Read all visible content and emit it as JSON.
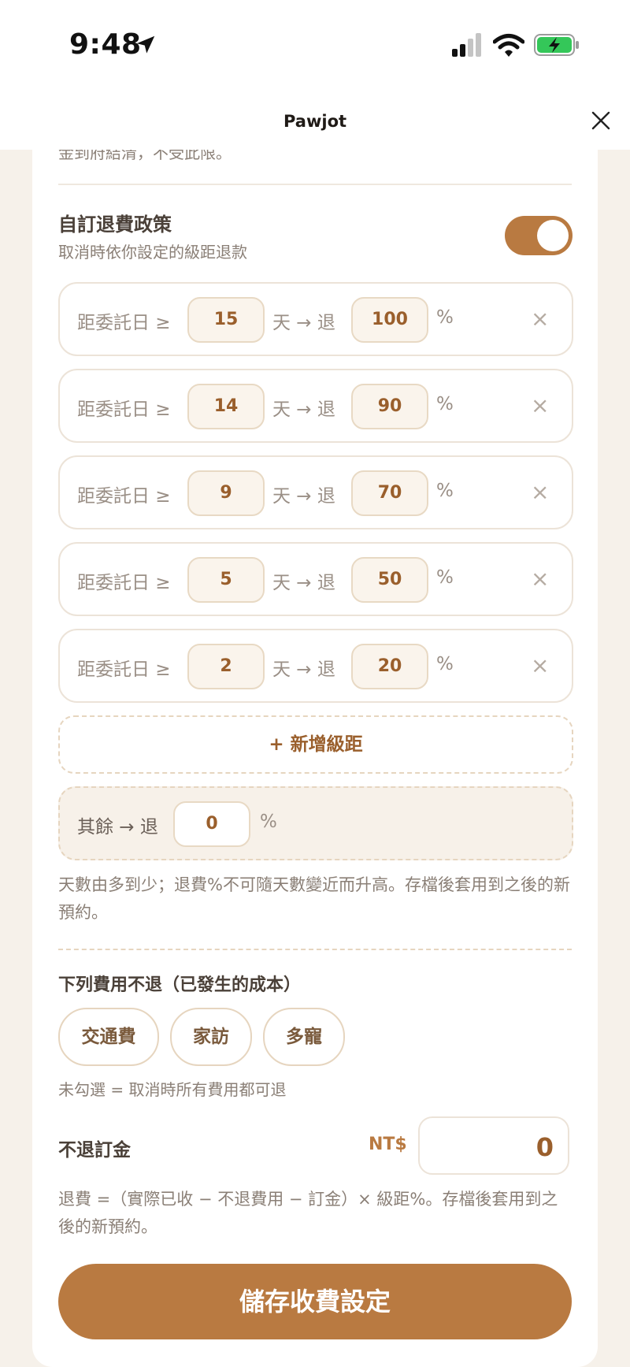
{
  "status_bar": {
    "time": "9:48"
  },
  "nav": {
    "title": "Pawjot"
  },
  "clipped_text": "金到府結清，不受此限。",
  "policy": {
    "title": "自訂退費政策",
    "subtitle": "取消時依你設定的級距退款",
    "enabled": true
  },
  "tier_labels": {
    "prefix": "距委託日 ≥",
    "middle": "天 → 退",
    "percent": "%",
    "remove": "×"
  },
  "tiers": [
    {
      "days": "15",
      "refund": "100"
    },
    {
      "days": "14",
      "refund": "90"
    },
    {
      "days": "9",
      "refund": "70"
    },
    {
      "days": "5",
      "refund": "50"
    },
    {
      "days": "2",
      "refund": "20"
    }
  ],
  "add_tier_label": "+ 新增級距",
  "rest": {
    "label": "其餘 → 退",
    "value": "0",
    "percent": "%"
  },
  "help_tiers": "天數由多到少；退費%不可隨天數變近而升高。存檔後套用到之後的新預約。",
  "non_refundable": {
    "title": "下列費用不退（已發生的成本）",
    "chips": [
      "交通費",
      "家訪",
      "多寵"
    ],
    "note": "未勾選 = 取消時所有費用都可退"
  },
  "deposit": {
    "label": "不退訂金",
    "currency": "NT$",
    "value": "0"
  },
  "help_formula": "退費 =（實際已收 − 不退費用 − 訂金）× 級距%。存檔後套用到之後的新預約。",
  "save_label": "儲存收費設定",
  "colors": {
    "accent": "#b97a41",
    "accent_dark": "#9a5f2c",
    "border": "#ece3d8",
    "background": "#f6f1ea"
  }
}
